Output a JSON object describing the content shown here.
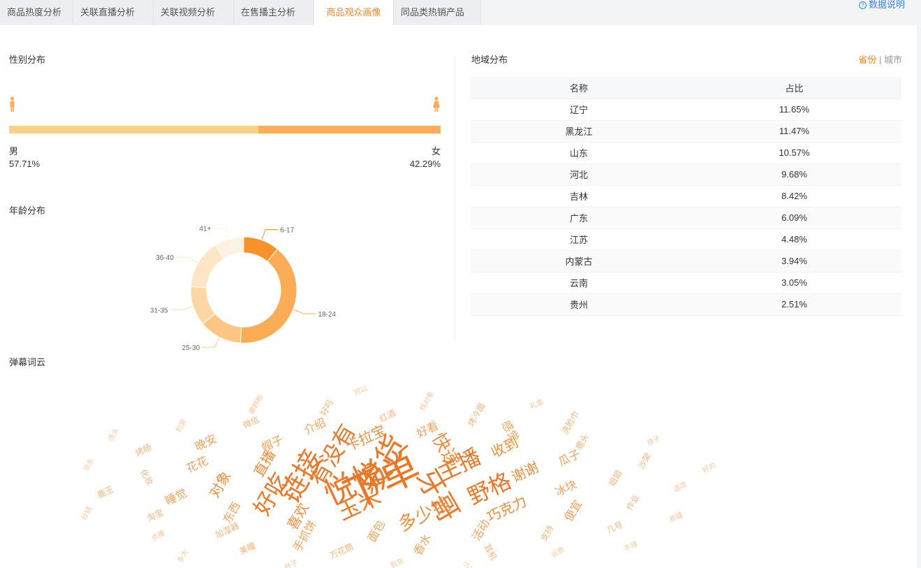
{
  "tabs": [
    "商品热度分析",
    "关联直播分析",
    "关联视频分析",
    "在售播主分析",
    "商品观众画像",
    "同品类热销产品"
  ],
  "active_tab": "商品观众画像",
  "help_label": "数据说明",
  "gender": {
    "title": "性别分布",
    "male_label": "男",
    "male_value": "57.71%",
    "male_fraction": 0.5771,
    "female_label": "女",
    "female_value": "42.29%",
    "female_fraction": 0.4229,
    "male_color": "#fdd08a",
    "female_color": "#fbad5c"
  },
  "age": {
    "title": "年龄分布",
    "chart_data": {
      "type": "pie",
      "categories": [
        "6-17",
        "18-24",
        "25-30",
        "31-35",
        "36-40",
        "41+"
      ],
      "values": [
        11,
        40,
        13,
        12,
        15,
        9
      ],
      "colors": [
        "#f7912a",
        "#fbac55",
        "#fdc683",
        "#fdd7a3",
        "#fde6c6",
        "#fef3e2"
      ]
    }
  },
  "region": {
    "title": "地域分布",
    "toggle_province": "省份",
    "toggle_sep": "|",
    "toggle_city": "城市",
    "columns": [
      "名称",
      "占比"
    ],
    "rows": [
      [
        "辽宁",
        "11.65%"
      ],
      [
        "黑龙江",
        "11.47%"
      ],
      [
        "山东",
        "10.57%"
      ],
      [
        "河北",
        "9.68%"
      ],
      [
        "吉林",
        "8.42%"
      ],
      [
        "广东",
        "6.09%"
      ],
      [
        "江苏",
        "4.48%"
      ],
      [
        "内蒙古",
        "3.94%"
      ],
      [
        "云南",
        "3.05%"
      ],
      [
        "贵州",
        "2.51%"
      ]
    ]
  },
  "wordcloud": {
    "title": "弹幕词云",
    "words": [
      {
        "text": "下单",
        "weight": 10
      },
      {
        "text": "悦悦",
        "weight": 8
      },
      {
        "text": "发货",
        "weight": 8
      },
      {
        "text": "牙哥",
        "weight": 7
      },
      {
        "text": "链接",
        "weight": 7
      },
      {
        "text": "主播",
        "weight": 6
      },
      {
        "text": "玉米",
        "weight": 6
      },
      {
        "text": "有没有",
        "weight": 6
      },
      {
        "text": "野格",
        "weight": 6
      },
      {
        "text": "好吃",
        "weight": 6
      },
      {
        "text": "快递",
        "weight": 5
      },
      {
        "text": "多少钱",
        "weight": 5
      },
      {
        "text": "直播",
        "weight": 4
      },
      {
        "text": "谢谢",
        "weight": 4
      },
      {
        "text": "喜欢",
        "weight": 4
      },
      {
        "text": "卡拉宝",
        "weight": 4
      },
      {
        "text": "巧克力",
        "weight": 4
      },
      {
        "text": "对象",
        "weight": 4
      },
      {
        "text": "收到",
        "weight": 4
      },
      {
        "text": "面包",
        "weight": 3
      },
      {
        "text": "帽子",
        "weight": 3
      },
      {
        "text": "冰块",
        "weight": 3
      },
      {
        "text": "东西",
        "weight": 3
      },
      {
        "text": "好看",
        "weight": 3
      },
      {
        "text": "活动",
        "weight": 3
      },
      {
        "text": "花花",
        "weight": 3
      },
      {
        "text": "瓜子",
        "weight": 3
      },
      {
        "text": "手抓饼",
        "weight": 3
      },
      {
        "text": "介绍",
        "weight": 3
      },
      {
        "text": "便宜",
        "weight": 3
      },
      {
        "text": "睡觉",
        "weight": 3
      },
      {
        "text": "感觉",
        "weight": 3
      },
      {
        "text": "香水",
        "weight": 3
      },
      {
        "text": "晚安",
        "weight": 3
      },
      {
        "text": "姐姐",
        "weight": 2
      },
      {
        "text": "加湿器",
        "weight": 2
      },
      {
        "text": "红酒",
        "weight": 2
      },
      {
        "text": "支持",
        "weight": 2
      },
      {
        "text": "化妆",
        "weight": 2
      },
      {
        "text": "鹿头",
        "weight": 2
      },
      {
        "text": "万花筒",
        "weight": 2
      },
      {
        "text": "微信",
        "weight": 2
      },
      {
        "text": "作业",
        "weight": 2
      },
      {
        "text": "淘宝",
        "weight": 2
      },
      {
        "text": "烤冷面",
        "weight": 2
      },
      {
        "text": "耳机",
        "weight": 2
      },
      {
        "text": "烤肠",
        "weight": 2
      },
      {
        "text": "沙架",
        "weight": 2
      },
      {
        "text": "美瞳",
        "weight": 2
      },
      {
        "text": "好吗",
        "weight": 2
      },
      {
        "text": "几号",
        "weight": 2
      },
      {
        "text": "鹿王",
        "weight": 2
      },
      {
        "text": "洗脸巾",
        "weight": 2
      },
      {
        "text": "到货",
        "weight": 1
      },
      {
        "text": "包装",
        "weight": 1
      },
      {
        "text": "选项",
        "weight": 1
      },
      {
        "text": "点播",
        "weight": 1
      },
      {
        "text": "找对象",
        "weight": 1
      },
      {
        "text": "运费",
        "weight": 1
      },
      {
        "text": "京东",
        "weight": 1
      },
      {
        "text": "孩子",
        "weight": 1
      },
      {
        "text": "杯子",
        "weight": 1
      },
      {
        "text": "螺蛳粉",
        "weight": 1
      },
      {
        "text": "新疆",
        "weight": 1
      },
      {
        "text": "砂锅",
        "weight": 1
      },
      {
        "text": "礼盒",
        "weight": 1
      },
      {
        "text": "小可爱",
        "weight": 1
      },
      {
        "text": "洗头",
        "weight": 1
      },
      {
        "text": "好的",
        "weight": 1
      },
      {
        "text": "多大",
        "weight": 1
      },
      {
        "text": "可以",
        "weight": 1
      },
      {
        "text": "不错",
        "weight": 1
      }
    ]
  }
}
